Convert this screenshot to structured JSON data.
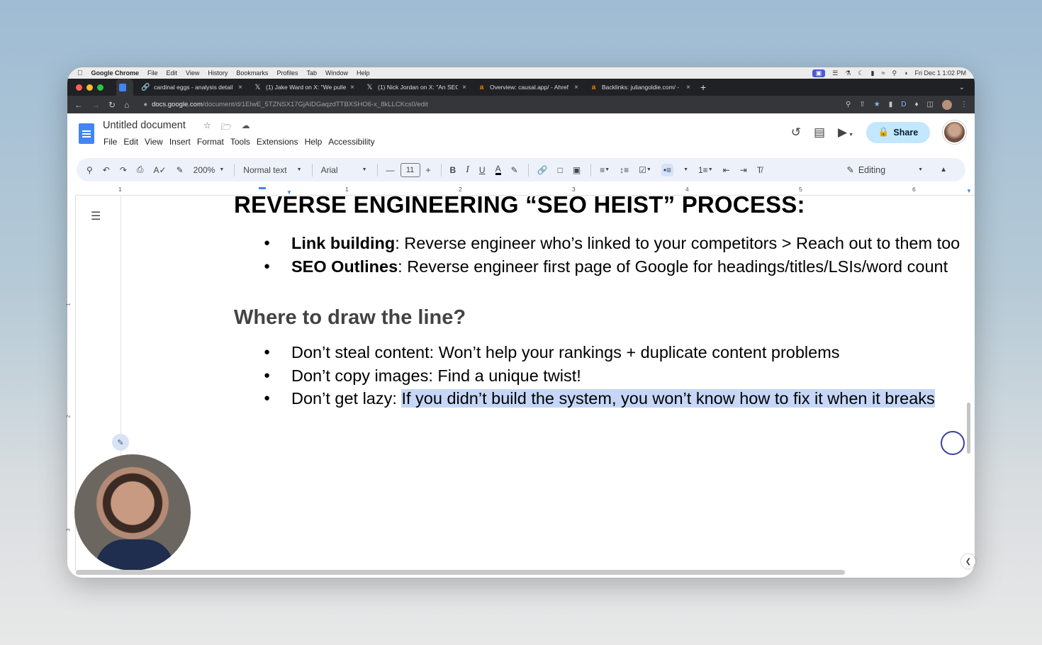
{
  "mac_menubar": {
    "app": "Google Chrome",
    "items": [
      "File",
      "Edit",
      "View",
      "History",
      "Bookmarks",
      "Profiles",
      "Tab",
      "Window",
      "Help"
    ],
    "clock": "Fri Dec 1  1:02 PM"
  },
  "browser": {
    "tabs": [
      {
        "title": "cardinal eggs - analysis detail",
        "icon": "docs-icon"
      },
      {
        "title": "(1) Jake Ward on X: \"We pulle",
        "icon": "x-icon"
      },
      {
        "title": "(1) Nick Jordan on X: \"An SEO",
        "icon": "x-icon"
      },
      {
        "title": "Overview: causal.app/ - Ahref",
        "icon": "ahrefs-icon"
      },
      {
        "title": "Backlinks: juliangoldie.com/ -",
        "icon": "ahrefs-icon"
      }
    ],
    "url_host": "docs.google.com",
    "url_path": "/document/d/1EIwE_5TZNSX17GjAIDGaqzdTTBXSHO6-x_8kLLCKcs0/edit"
  },
  "docs": {
    "title": "Untitled document",
    "menu": [
      "File",
      "Edit",
      "View",
      "Insert",
      "Format",
      "Tools",
      "Extensions",
      "Help",
      "Accessibility"
    ],
    "share_label": "Share"
  },
  "toolbar": {
    "zoom": "200%",
    "style": "Normal text",
    "font": "Arial",
    "font_size": "11",
    "mode": "Editing",
    "bold": "B",
    "italic": "I",
    "underline": "U",
    "color": "A"
  },
  "ruler": {
    "marks": [
      "1",
      "1",
      "2",
      "3",
      "4",
      "5",
      "6"
    ],
    "vmarks": [
      "1",
      "2",
      "3"
    ]
  },
  "document": {
    "heading1": "REVERSE ENGINEERING “SEO HEIST” PROCESS:",
    "list1": [
      {
        "bold": "Link building",
        "text": ": Reverse engineer who’s linked to your competitors > Reach out to them too"
      },
      {
        "bold": "SEO Outlines",
        "text": ": Reverse engineer first page of Google for headings/titles/LSIs/word count"
      }
    ],
    "heading2": "Where to draw the line?",
    "list2": [
      {
        "text": "Don’t steal content: Won’t help your rankings + duplicate content problems"
      },
      {
        "text": "Don’t copy images: Find a unique twist!"
      },
      {
        "prefix": "Don’t get lazy: ",
        "selected": "If you didn’t build the system, you won’t know how to fix it when it breaks"
      }
    ]
  },
  "colors": {
    "share_bg": "#c2e7ff",
    "toolbar_bg": "#edf2fa",
    "selection": "#c6d6f6",
    "docs_blue": "#4285f4"
  }
}
